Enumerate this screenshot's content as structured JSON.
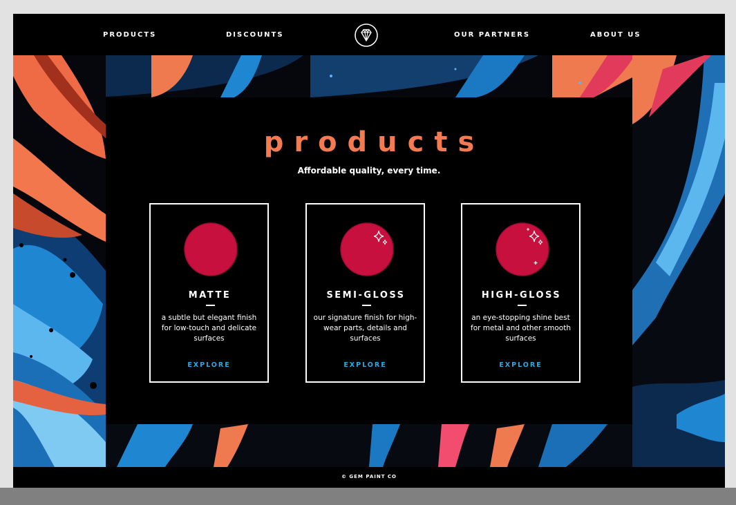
{
  "nav": {
    "items": [
      {
        "label": "PRODUCTS"
      },
      {
        "label": "DISCOUNTS"
      },
      {
        "label": "OUR PARTNERS"
      },
      {
        "label": "ABOUT US"
      }
    ],
    "logo_icon": "diamond-icon"
  },
  "main": {
    "title": "products",
    "subtitle": "Affordable quality, every time.",
    "cards": [
      {
        "name": "MATTE",
        "description": "a subtle but elegant finish for low-touch and delicate surfaces",
        "cta": "EXPLORE",
        "icon": "matte-paint-ball-icon"
      },
      {
        "name": "SEMI-GLOSS",
        "description": "our signature finish for high-wear parts, details and surfaces",
        "cta": "EXPLORE",
        "icon": "semi-gloss-paint-ball-icon"
      },
      {
        "name": "HIGH-GLOSS",
        "description": "an eye-stopping shine best for metal and other smooth surfaces",
        "cta": "EXPLORE",
        "icon": "high-gloss-paint-ball-icon"
      }
    ]
  },
  "footer": {
    "text": "© GEM PAINT CO"
  },
  "colors": {
    "accent": "#f47a52",
    "link": "#2fa6e6",
    "paint": "#c8103f",
    "background": "#000000"
  }
}
